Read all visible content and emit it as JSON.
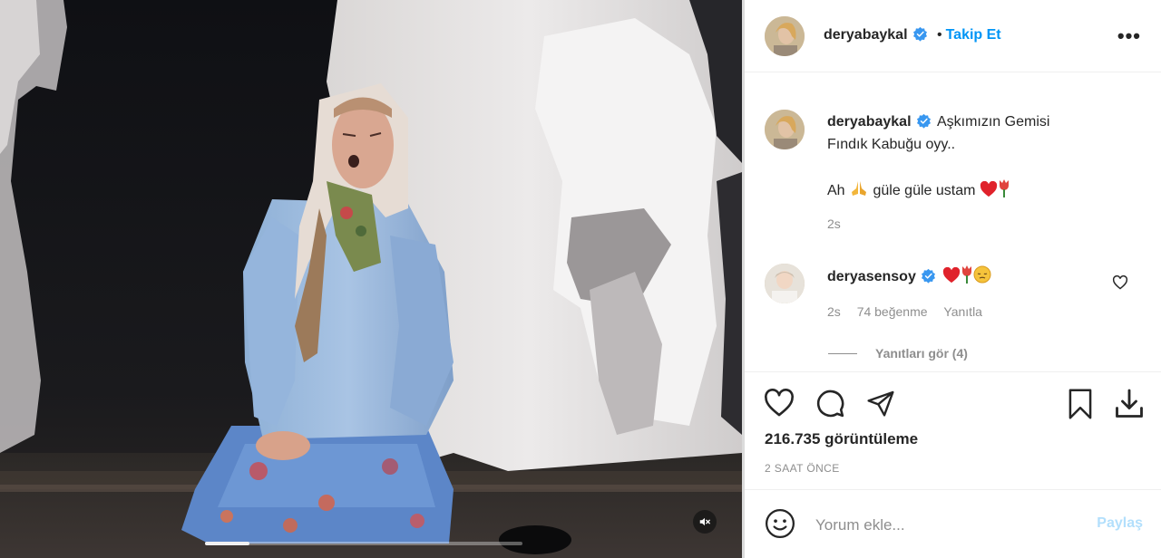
{
  "media": {
    "progress_fraction": 0.14,
    "mute_icon": "speaker-muted-icon"
  },
  "post": {
    "author": "deryabaykal",
    "verified": true,
    "separator": "•",
    "follow_label": "Takip Et",
    "more_icon": "more-dots-icon",
    "caption_line1": "Aşkımızın Gemisi",
    "caption_line2": "Fındık Kabuğu oyy..",
    "caption_line3_text1": "Ah",
    "caption_line3_text2": "güle güle ustam",
    "caption_emojis": [
      "folded-hands-icon",
      "red-heart-icon",
      "tulip-icon"
    ],
    "caption_time": "2s"
  },
  "comments": [
    {
      "user": "deryasensoy",
      "verified": true,
      "emojis": [
        "red-heart-icon",
        "tulip-icon",
        "pensive-face-icon"
      ],
      "time": "2s",
      "likes": "74 beğenme",
      "reply_label": "Yanıtla",
      "view_replies": "Yanıtları gör (4)"
    }
  ],
  "actions": {
    "views": "216.735 görüntüleme",
    "time_ago": "2 SAAT ÖNCE"
  },
  "compose": {
    "placeholder": "Yorum ekle...",
    "share_label": "Paylaş"
  },
  "colors": {
    "link_blue": "#0095f6",
    "share_disabled": "#b2dffc",
    "heart_red": "#e0222b"
  }
}
